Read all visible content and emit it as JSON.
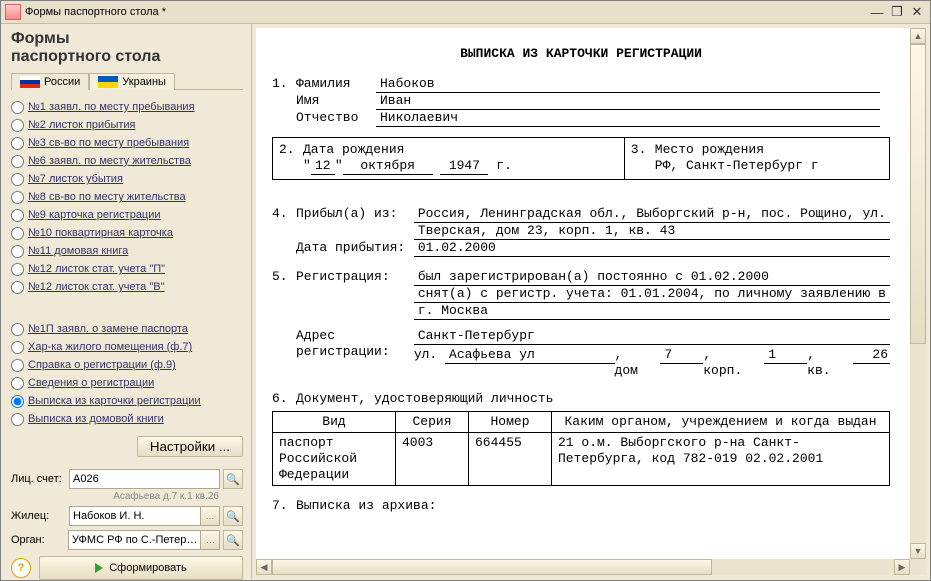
{
  "window": {
    "title": "Формы паспортного стола *"
  },
  "side": {
    "heading": "Формы\nпаспортного стола",
    "tabs": {
      "ru": "России",
      "ua": "Украины"
    },
    "forms1": [
      "№1  заявл. по месту пребывания",
      "№2  листок прибытия",
      "№3  св-во по месту пребывания",
      "№6  заявл. по месту жительства",
      "№7  листок убытия",
      "№8  св-во по месту жительства",
      "№9  карточка регистрации",
      "№10 поквартирная карточка",
      "№11 домовая книга",
      "№12 листок стат. учета \"П\"",
      "№12 листок стат. учета \"В\""
    ],
    "forms2": [
      "№1П  заявл. о замене паспорта",
      "Хар-ка жилого помещения (ф.7)",
      "Справка о регистрации (ф.9)",
      "Сведения о регистрации",
      "Выписка из карточки регистрации",
      "Выписка из домовой книги"
    ],
    "selected_form_index": 4,
    "btn_settings": "Настройки ...",
    "field_account": {
      "label": "Лиц. счет:",
      "value": "А026",
      "hint": "Асафьева д.7 к.1 кв.26"
    },
    "field_resident": {
      "label": "Жилец:",
      "value": "Набоков И. Н."
    },
    "field_org": {
      "label": "Орган:",
      "value": "УФМС РФ по С.-Петер…"
    },
    "btn_generate": "Сформировать"
  },
  "doc": {
    "title": "ВЫПИСКА ИЗ КАРТОЧКИ РЕГИСТРАЦИИ",
    "s1": {
      "label_last": "Фамилия",
      "last": "Набоков",
      "label_first": "Имя",
      "first": "Иван",
      "label_pat": "Отчество",
      "pat": "Николаевич"
    },
    "s2": {
      "label": "Дата рождения",
      "day": "12",
      "month": "октября",
      "year": "1947",
      "year_suffix": "г."
    },
    "s3": {
      "label": "Место рождения",
      "value": "РФ, Санкт-Петербург г"
    },
    "s4": {
      "label": "Прибыл(а) из:",
      "line1": "Россия, Ленинградская обл., Выборгский р-н, пос. Рощино, ул.",
      "line2": "Тверская, дом 23, корп. 1, кв. 43",
      "date_label": "Дата прибытия:",
      "date": "01.02.2000"
    },
    "s5": {
      "label": "Регистрация:",
      "line1": "был зарегистрирован(а) постоянно с 01.02.2000",
      "line2": "снят(а) с регистр. учета: 01.01.2004, по личному заявлению в",
      "line3": "г. Москва",
      "addr_label": "Адрес\nрегистрации:",
      "city": "Санкт-Петербург",
      "street_prefix": "ул.",
      "street": "Асафьева ул",
      "house_label": ", дом",
      "house": "7",
      "korp_label": ", корп.",
      "korp": "1",
      "flat_label": ", кв.",
      "flat": "26"
    },
    "s6": {
      "label": "Документ, удостоверяющий личность",
      "th_type": "Вид",
      "th_ser": "Серия",
      "th_num": "Номер",
      "th_issued": "Каким органом, учреждением и когда выдан",
      "type": "паспорт Российской Федерации",
      "ser": "4003",
      "num": "664455",
      "issued": "21 о.м. Выборгского р-на Санкт-Петербурга, код 782-019 02.02.2001"
    },
    "s7": {
      "label": "Выписка из архива:"
    }
  }
}
